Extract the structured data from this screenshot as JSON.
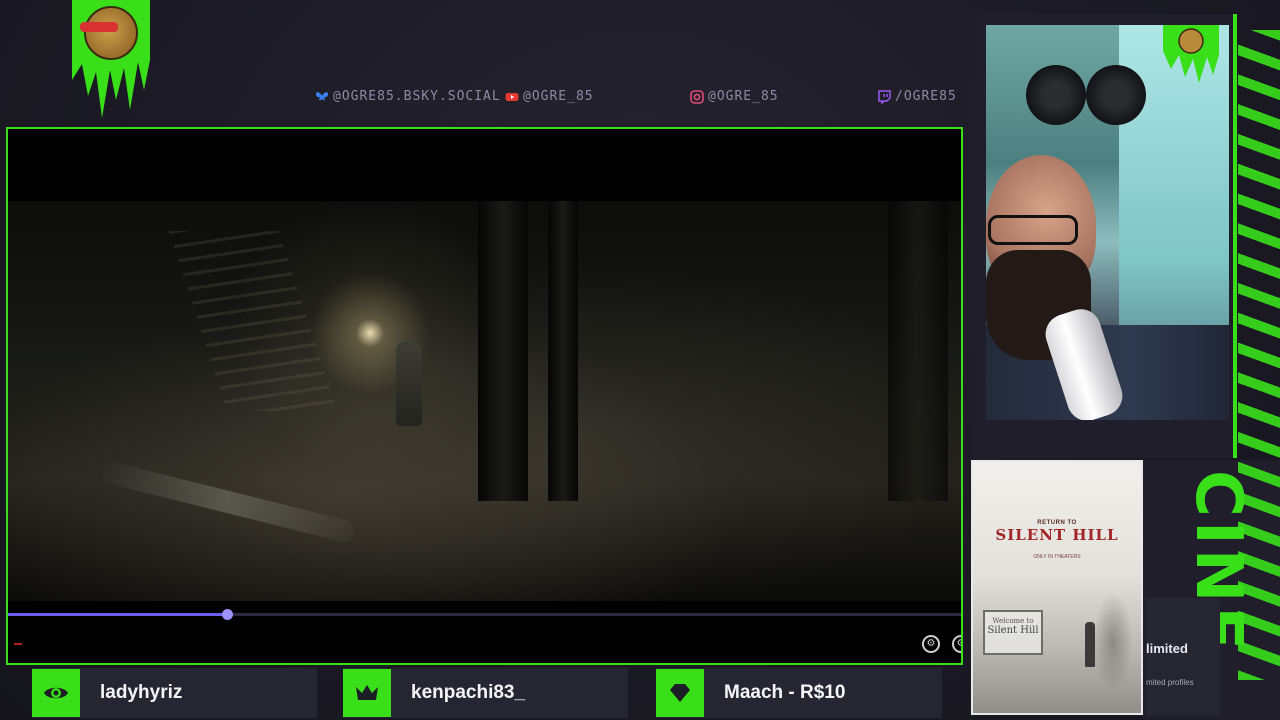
{
  "socials": [
    {
      "platform": "bluesky",
      "icon": "butterfly-icon",
      "handle": "@OGRE85.BSKY.SOCIAL",
      "color": "#3b82f6"
    },
    {
      "platform": "youtube",
      "icon": "youtube-icon",
      "handle": "@OGRE_85",
      "color": "#e53935"
    },
    {
      "platform": "instagram",
      "icon": "instagram-icon",
      "handle": "@OGRE_85",
      "color": "#e24a7a"
    },
    {
      "platform": "twitch",
      "icon": "twitch-icon",
      "handle": "/OGRE85",
      "color": "#9b59f5"
    }
  ],
  "player": {
    "progress": 0.23,
    "accent": "#6c5cf2"
  },
  "poster": {
    "pretitle": "RETURN TO",
    "title": "SILENT HILL",
    "tagline": "ONLY IN THEATERS",
    "sign_line1": "Welcome to",
    "sign_line2": "Silent Hill"
  },
  "side_panel": {
    "cine_text": "CINE",
    "limited_label": "limited",
    "limited_sub": "mited profiles"
  },
  "alerts": [
    {
      "type": "follower",
      "icon": "eye-icon",
      "name": "ladyhyriz"
    },
    {
      "type": "subscriber",
      "icon": "crown-icon",
      "name": "kenpachi83_"
    },
    {
      "type": "donation",
      "icon": "diamond-icon",
      "name": "Maach - R$10"
    }
  ],
  "theme": {
    "accent_green": "#39e01a",
    "panel_bg": "#262633"
  }
}
